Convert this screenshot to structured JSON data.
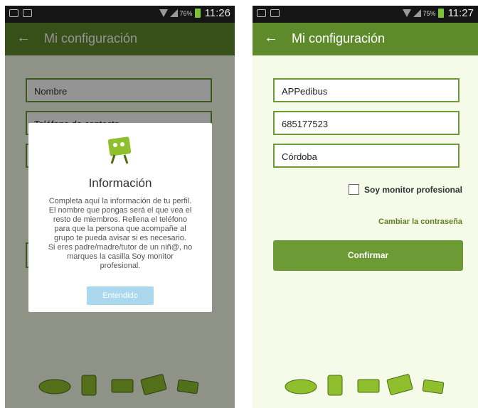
{
  "status": {
    "left_time": "11:26",
    "left_battery": "76%",
    "right_time": "11:27",
    "right_battery": "75%"
  },
  "app_title": "Mi configuración",
  "left": {
    "fields": [
      "Nombre",
      "Teléfono de contacto"
    ],
    "dialog": {
      "title": "Información",
      "body": "Completa aquí la información de tu perfil.\nEl nombre que pongas será el que vea el\nresto de miembros. Rellena el teléfono\npara que la persona que acompañe al\ngrupo te pueda avisar si es necesario.\nSi eres padre/madre/tutor de un niñ@, no\nmarques la casilla Soy monitor\nprofesional.",
      "button": "Entendido"
    }
  },
  "right": {
    "fields": [
      "APPedibus",
      "685177523",
      "Córdoba"
    ],
    "checkbox_label": "Soy monitor profesional",
    "checkbox_checked": false,
    "change_password": "Cambiar la contraseña",
    "confirm": "Confirmar"
  },
  "colors": {
    "app_bar": "#5f8a2c",
    "field_border": "#6c9a34",
    "mascot_green": "#8fbf2c",
    "dialog_button": "#a9d8ef"
  }
}
